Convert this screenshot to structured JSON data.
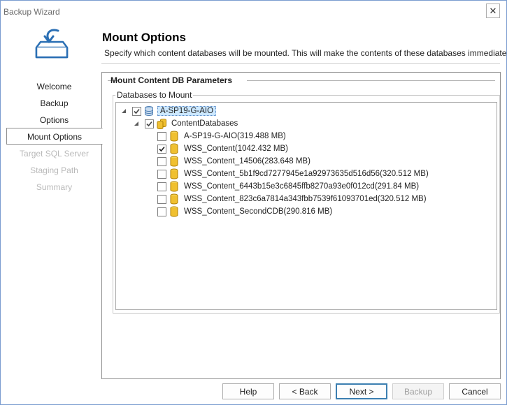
{
  "window": {
    "title": "Backup Wizard",
    "close_glyph": "✕"
  },
  "header": {
    "title": "Mount Options",
    "description": "Specify which content databases will be mounted. This will make the contents of these databases immediately..."
  },
  "nav": {
    "items": [
      {
        "label": "Welcome",
        "state": "normal"
      },
      {
        "label": "Backup",
        "state": "normal"
      },
      {
        "label": "Options",
        "state": "normal"
      },
      {
        "label": "Mount Options",
        "state": "selected"
      },
      {
        "label": "Target SQL Server",
        "state": "disabled"
      },
      {
        "label": "Staging Path",
        "state": "disabled"
      },
      {
        "label": "Summary",
        "state": "disabled"
      }
    ]
  },
  "group": {
    "title": "Mount Content DB Parameters",
    "legend": "Databases to Mount"
  },
  "tree": {
    "server": {
      "label": "A-SP19-G-AIO",
      "checked": "partial",
      "expanded": true,
      "icon": "server-database-icon"
    },
    "folder": {
      "label": "ContentDatabases",
      "checked": "partial",
      "expanded": true,
      "icon": "databases-folder-icon"
    },
    "databases": [
      {
        "label": "A-SP19-G-AIO(319.488 MB)",
        "checked": false,
        "icon": "database-icon"
      },
      {
        "label": "WSS_Content(1042.432 MB)",
        "checked": true,
        "icon": "database-icon"
      },
      {
        "label": "WSS_Content_14506(283.648 MB)",
        "checked": false,
        "icon": "database-icon"
      },
      {
        "label": "WSS_Content_5b1f9cd7277945e1a92973635d516d56(320.512 MB)",
        "checked": false,
        "icon": "database-icon"
      },
      {
        "label": "WSS_Content_6443b15e3c6845ffb8270a93e0f012cd(291.84 MB)",
        "checked": false,
        "icon": "database-icon"
      },
      {
        "label": "WSS_Content_823c6a7814a343fbb7539f61093701ed(320.512 MB)",
        "checked": false,
        "icon": "database-icon"
      },
      {
        "label": "WSS_Content_SecondCDB(290.816 MB)",
        "checked": false,
        "icon": "database-icon"
      }
    ]
  },
  "buttons": {
    "help": "Help",
    "back": "< Back",
    "next": "Next >",
    "backup": "Backup",
    "cancel": "Cancel"
  },
  "colors": {
    "accent": "#3c7fb1",
    "selection": "#cce8ff",
    "database_gold": "#e8b300"
  }
}
